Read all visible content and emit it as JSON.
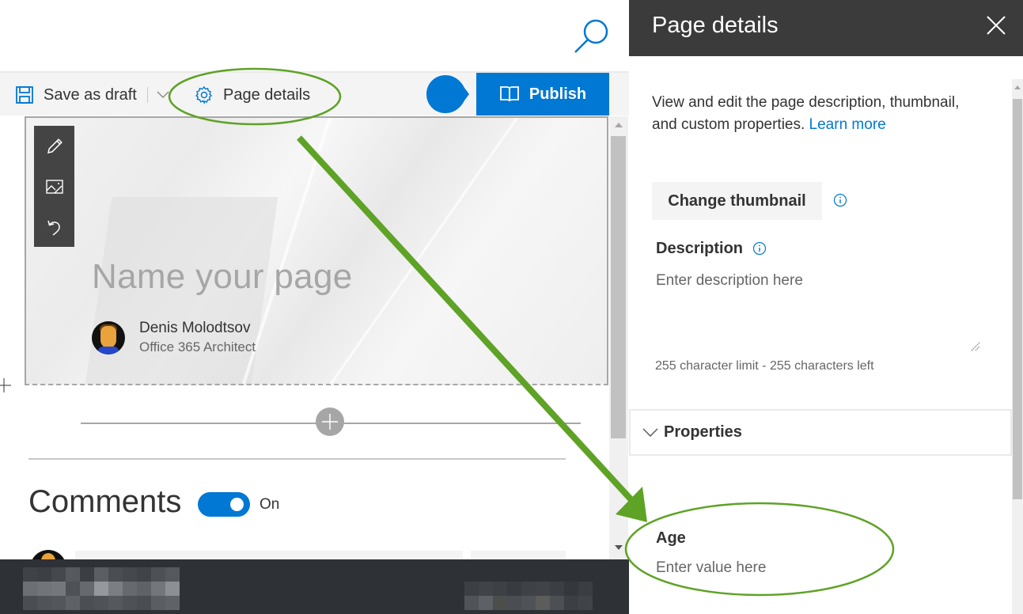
{
  "topbar": {
    "search_icon": "search-icon"
  },
  "command_bar": {
    "save_draft_label": "Save as draft",
    "page_details_label": "Page details",
    "publish_label": "Publish"
  },
  "hero": {
    "toolbar_icons": [
      "pencil-icon",
      "image-edit-icon",
      "undo-icon"
    ],
    "title_placeholder": "Name your page",
    "author_name": "Denis Molodtsov",
    "author_role": "Office 365 Architect"
  },
  "comments": {
    "heading": "Comments",
    "toggle_state_label": "On",
    "toggle_on": true
  },
  "panel": {
    "title": "Page details",
    "description_text": "View and edit the page description, thumbnail, and custom properties.",
    "learn_more_label": "Learn more",
    "change_thumbnail_label": "Change thumbnail",
    "description_label": "Description",
    "description_placeholder": "Enter description here",
    "description_value": "",
    "char_limit_text": "255 character limit - 255 characters left",
    "properties_label": "Properties",
    "fields": [
      {
        "label": "Age",
        "placeholder": "Enter value here",
        "value": ""
      }
    ]
  },
  "colors": {
    "accent": "#0078d4",
    "panel_header": "#3b3b3b",
    "annotation_green": "#5ea226",
    "taskbar": "#2e3136"
  }
}
